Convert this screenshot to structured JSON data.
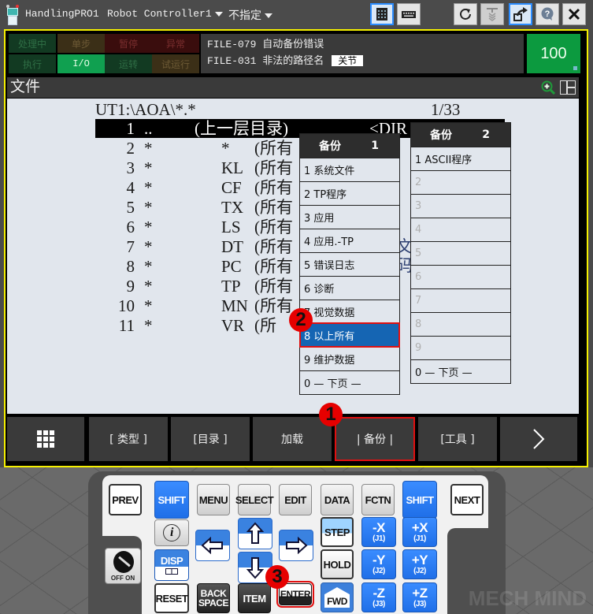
{
  "titlebar": {
    "app_name": "HandlingPRO1",
    "controller": "Robot Controller1",
    "group": "不指定",
    "buttons": [
      {
        "name": "teach-pendant-view",
        "icon": "teach-pendant-icon",
        "active": true
      },
      {
        "name": "keyboard-view",
        "icon": "keyboard-icon",
        "active": false
      },
      {
        "name": "refresh",
        "icon": "refresh-icon",
        "active": false
      },
      {
        "name": "robot-toggle",
        "icon": "robot-arm-icon",
        "active": false
      },
      {
        "name": "external-window",
        "icon": "external-window-icon",
        "active": true
      },
      {
        "name": "help",
        "icon": "help-icon",
        "active": false
      },
      {
        "name": "close",
        "icon": "close-icon",
        "active": false
      }
    ]
  },
  "status": {
    "leds": [
      "处理中",
      "单步",
      "暂停",
      "异常",
      "执行",
      "I/O",
      "运转",
      "试运行"
    ],
    "alarm_line1": "FILE-079 自动备份错误",
    "alarm_line2": "FILE-031 非法的路径名",
    "alarm_tag": "关节",
    "override": "100"
  },
  "screen": {
    "title": "文件",
    "path": "UT1:\\AOA\\*.*",
    "page": "1/33",
    "rows": [
      {
        "num": "1",
        "star": "..",
        "ext": "",
        "desc": "(上一层目录)",
        "type": "<DIR"
      },
      {
        "num": "2",
        "star": "*",
        "ext": "*",
        "desc": "(所有"
      },
      {
        "num": "3",
        "star": "*",
        "ext": "KL",
        "desc": "(所有"
      },
      {
        "num": "4",
        "star": "*",
        "ext": "CF",
        "desc": "(所有"
      },
      {
        "num": "5",
        "star": "*",
        "ext": "TX",
        "desc": "(所有"
      },
      {
        "num": "6",
        "star": "*",
        "ext": "LS",
        "desc": "(所有"
      },
      {
        "num": "7",
        "star": "*",
        "ext": "DT",
        "desc": "(所有"
      },
      {
        "num": "8",
        "star": "*",
        "ext": "PC",
        "desc": "(所有"
      },
      {
        "num": "9",
        "star": "*",
        "ext": "TP",
        "desc": "(所有"
      },
      {
        "num": "10",
        "star": "*",
        "ext": "MN",
        "desc": "(所有"
      },
      {
        "num": "11",
        "star": "*",
        "ext": "VR",
        "desc": "(所"
      }
    ],
    "partial_text_1": "文",
    "partial_text_2": "码"
  },
  "popup1": {
    "title": "备份",
    "page": "1",
    "items": [
      "1 系统文件",
      "2 TP程序",
      "3 应用",
      "4 应用.-TP",
      "5 错误日志",
      "6 诊断",
      "7 视觉数据",
      "8 以上所有",
      "9 维护数据",
      "0 — 下页 —"
    ],
    "selected_index": 7
  },
  "popup2": {
    "title": "备份",
    "page": "2",
    "items": [
      "1 ASCII程序",
      "2",
      "3",
      "4",
      "5",
      "6",
      "7",
      "8",
      "9",
      "0 — 下页 —"
    ]
  },
  "fkeys": {
    "menu_icon": "grid-menu-icon",
    "f1": "[ 类型 ]",
    "f2": "[目录 ]",
    "f3": "加载",
    "f4": "| 备份 |",
    "f5": "[工具 ]",
    "next_icon": "chevron-right-icon"
  },
  "callouts": [
    "1",
    "2",
    "3"
  ],
  "keypad": {
    "prev": "PREV",
    "shift_left": "SHIFT",
    "menu": "MENU",
    "select": "SELECT",
    "edit": "EDIT",
    "data": "DATA",
    "fctn": "FCTN",
    "shift_right": "SHIFT",
    "next": "NEXT",
    "info": "i",
    "disp": "DISP",
    "reset": "RESET",
    "backspace_1": "BACK",
    "backspace_2": "SPACE",
    "item": "ITEM",
    "enter": "ENTER",
    "step": "STEP",
    "hold": "HOLD",
    "fwd": "FWD",
    "jog": [
      {
        "label": "-X",
        "sub": "(J1)"
      },
      {
        "label": "+X",
        "sub": "(J1)"
      },
      {
        "label": "-Y",
        "sub": "(J2)"
      },
      {
        "label": "+Y",
        "sub": "(J2)"
      },
      {
        "label": "-Z",
        "sub": "(J3)"
      },
      {
        "label": "+Z",
        "sub": "(J3)"
      }
    ],
    "switch_label": "OFF  ON"
  },
  "watermark": "MECH MIND"
}
